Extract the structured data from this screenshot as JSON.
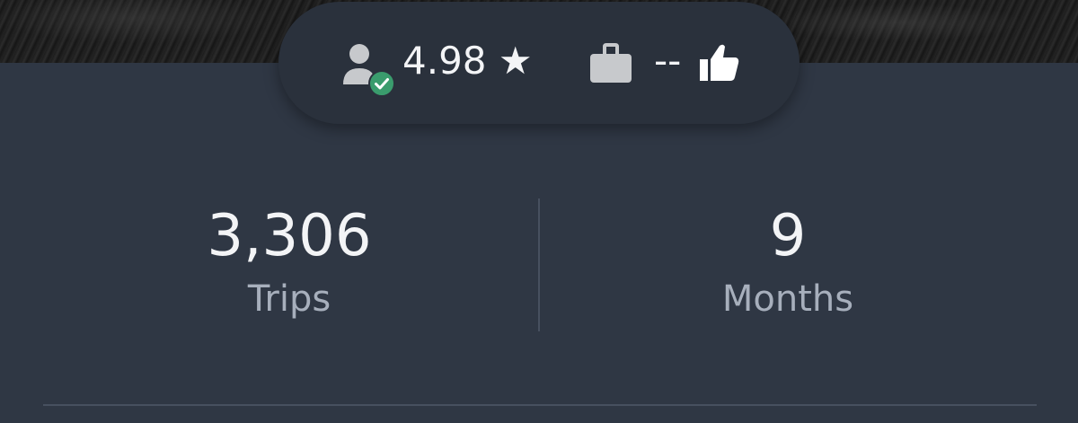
{
  "header": {
    "background": "photo"
  },
  "badges": {
    "rating_value": "4.98 ★",
    "compliments_value": "--",
    "icons": [
      "verified-person-icon",
      "briefcase-icon",
      "thumbs-up-icon"
    ]
  },
  "stats": [
    {
      "value": "3,306",
      "label": "Trips"
    },
    {
      "value": "9",
      "label": "Months"
    }
  ],
  "colors": {
    "panel": "#2f3744",
    "pill": "#2a313c",
    "text_primary": "#f3f4f6",
    "text_secondary": "#a7afbc",
    "icon": "#c7c9cc",
    "verified_green": "#3a9c6d",
    "divider": "#47505f"
  }
}
